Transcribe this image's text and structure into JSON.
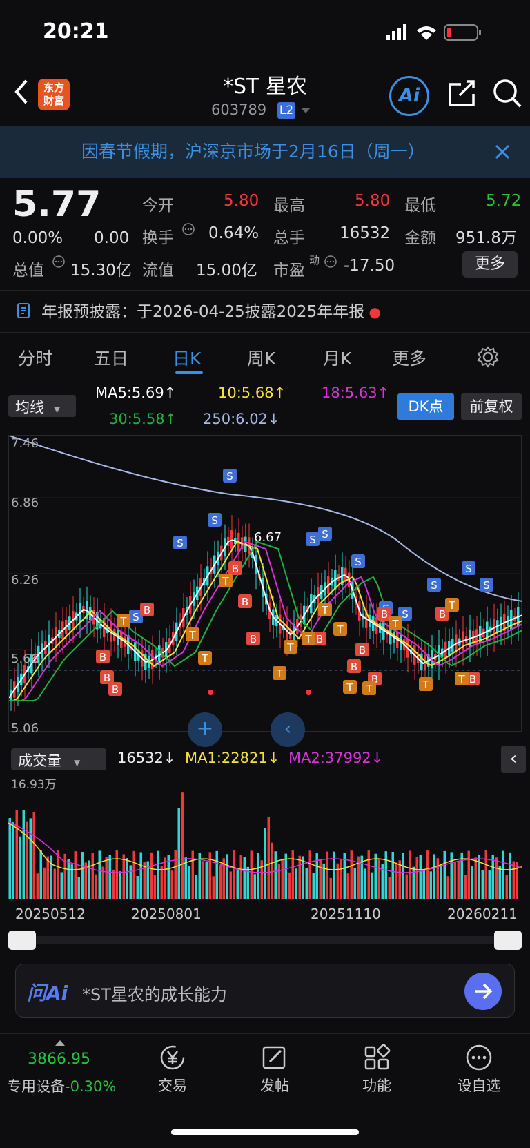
{
  "status": {
    "time": "20:21"
  },
  "header": {
    "title": "*ST 星农",
    "code": "603789",
    "level": "L2",
    "logo_line1": "东方",
    "logo_line2": "财富",
    "ai_label": "Ai"
  },
  "notice": {
    "text": "因春节假期，沪深京市场于2月16日（周一）"
  },
  "quote": {
    "price": "5.77",
    "change_pct": "0.00%",
    "change": "0.00",
    "open_label": "今开",
    "open": "5.80",
    "high_label": "最高",
    "high": "5.80",
    "low_label": "最低",
    "low": "5.72",
    "turnover_label": "换手",
    "turnover": "0.64%",
    "volume_label": "总手",
    "volume": "16532",
    "amount_label": "金额",
    "amount": "951.8万",
    "mktcap_label": "总值",
    "mktcap": "15.30亿",
    "float_label": "流值",
    "float": "15.00亿",
    "pe_label": "市盈",
    "pe_sup": "动",
    "pe": "-17.50",
    "more": "更多"
  },
  "report": {
    "text": "年报预披露：于2026-04-25披露2025年年报"
  },
  "tabs": [
    "分时",
    "五日",
    "日K",
    "周K",
    "月K",
    "更多"
  ],
  "ma": {
    "selector": "均线",
    "ma5": "MA5:5.69",
    "ma10": "10:5.68",
    "ma18": "18:5.63",
    "ma30": "30:5.58",
    "ma250": "250:6.02",
    "dk": "DK点",
    "adjust": "前复权"
  },
  "chart": {
    "y_top": "7.46",
    "y1": "6.86",
    "y2": "6.26",
    "y3": "5.66",
    "y_bottom": "5.06",
    "annot": "6.67",
    "colors": {
      "up": "#f03838",
      "down": "#2fd6d6",
      "ma5": "#ffffff",
      "ma10": "#f5e03a",
      "ma18": "#d633d6",
      "ma30": "#1fb040",
      "ma250": "#a8b8e8"
    }
  },
  "volume": {
    "selector": "成交量",
    "value": "16532",
    "ma1": "MA1:22821",
    "ma2": "MA2:37992",
    "max": "16.93万"
  },
  "dates": [
    "20250512",
    "20250801",
    "20251110",
    "20260211"
  ],
  "ask": {
    "brand": "问Ai",
    "text": "*ST星农的成长能力"
  },
  "nav": {
    "index_value": "3866.95",
    "index_name": "专用设备",
    "index_change": "-0.30%",
    "trade": "交易",
    "post": "发帖",
    "func": "功能",
    "watch": "设自选"
  }
}
